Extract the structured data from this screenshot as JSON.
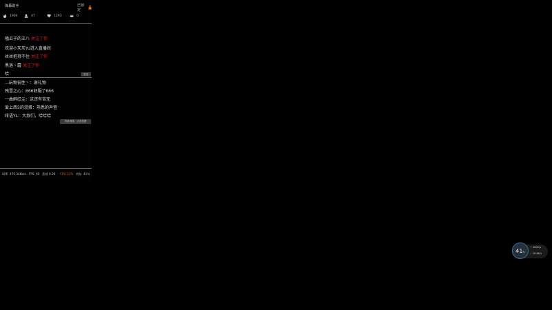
{
  "panel": {
    "title": "弹幕助手",
    "lock_label": "已锁定"
  },
  "stats": [
    {
      "icon": "flame-icon",
      "value": "1904"
    },
    {
      "icon": "fans-icon",
      "value": "47"
    },
    {
      "icon": "heart-icon",
      "value": "1293"
    },
    {
      "icon": "crown-icon",
      "value": "0"
    }
  ],
  "follow_notices": [
    {
      "name": "嗑瓜子的王八",
      "action": "关注了你"
    },
    {
      "prefix": "欢迎",
      "name": "小灰灰Yu",
      "action": "进入直播间"
    },
    {
      "name": "丝丝把持不住",
      "action": "关注了你"
    },
    {
      "name": "黑洛丶蘑",
      "action": "关注了你"
    }
  ],
  "input": {
    "text": "哈",
    "send_label": "发送"
  },
  "chat_messages": [
    {
      "user": "...玩物丧性丶",
      "text": "谢礼物"
    },
    {
      "user": "残雪之心",
      "text": "666舒服了666"
    },
    {
      "user": "一曲醉红尘",
      "text": "这还有苦无"
    },
    {
      "user": "爱上西5的混蛋",
      "text": "熟悉的声音"
    },
    {
      "user": "绯语YL",
      "text": "大叔们，哈哈哈"
    }
  ],
  "more_button_label": "有新消息，点击查看",
  "status_bar": {
    "bitrate_label": "码率",
    "bitrate": "470.34Kb/s",
    "fps_label": "FPS",
    "fps": "60",
    "lost_label": "丢帧",
    "lost": "0.00",
    "cpu_label": "CPU",
    "cpu": "22%",
    "mem_label": "内存",
    "mem": "41%"
  },
  "net_widget": {
    "percent": "41",
    "percent_unit": "%",
    "upload": "280",
    "upload_unit": "K/s",
    "download": "28.6",
    "download_unit": "K/s"
  },
  "colors": {
    "background": "#000000",
    "highlight_red": "#e02020",
    "cpu_orange": "#e05a20",
    "upload_green": "#3ea84a",
    "download_blue": "#3b8fd8"
  }
}
